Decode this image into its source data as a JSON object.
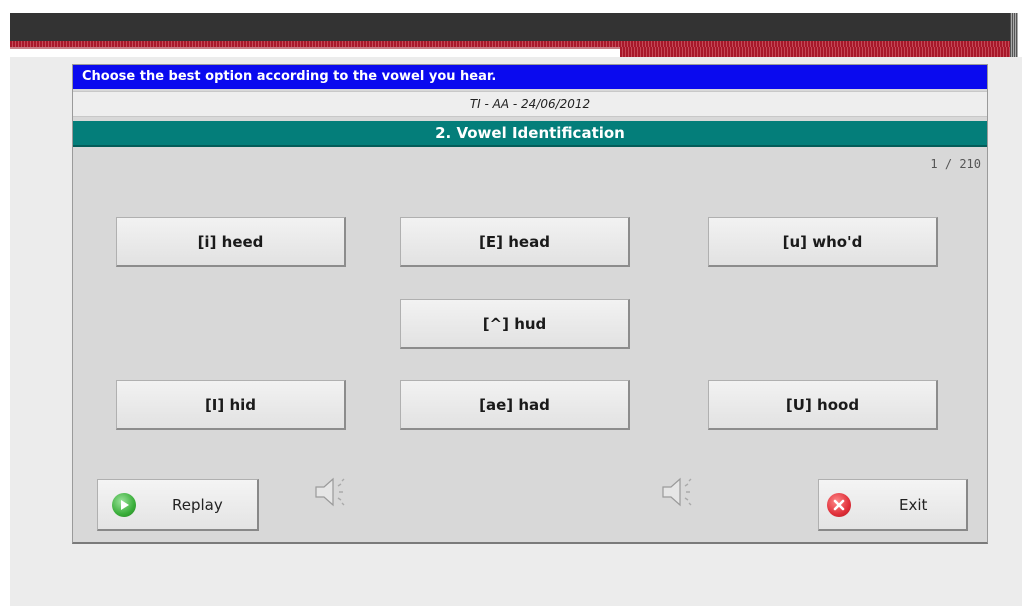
{
  "instruction": "Choose the best option according to the vowel you hear.",
  "session": "TI - AA - 24/06/2012",
  "section_title": "2. Vowel Identification",
  "counter": "1 / 210",
  "vowels": {
    "heed": "[i] heed",
    "head": "[E] head",
    "whod": "[u] who'd",
    "hud": "[^] hud",
    "hid": "[I] hid",
    "had": "[ae] had",
    "hood": "[U] hood"
  },
  "controls": {
    "replay": "Replay",
    "exit": "Exit"
  },
  "colors": {
    "instruction_bar": "#0a0aef",
    "section_bar": "#047e7a",
    "replay_icon": "#3aae3a",
    "exit_icon": "#e0303a"
  },
  "icons": {
    "replay": "play-icon",
    "exit": "close-icon",
    "sound": "speaker-icon"
  }
}
